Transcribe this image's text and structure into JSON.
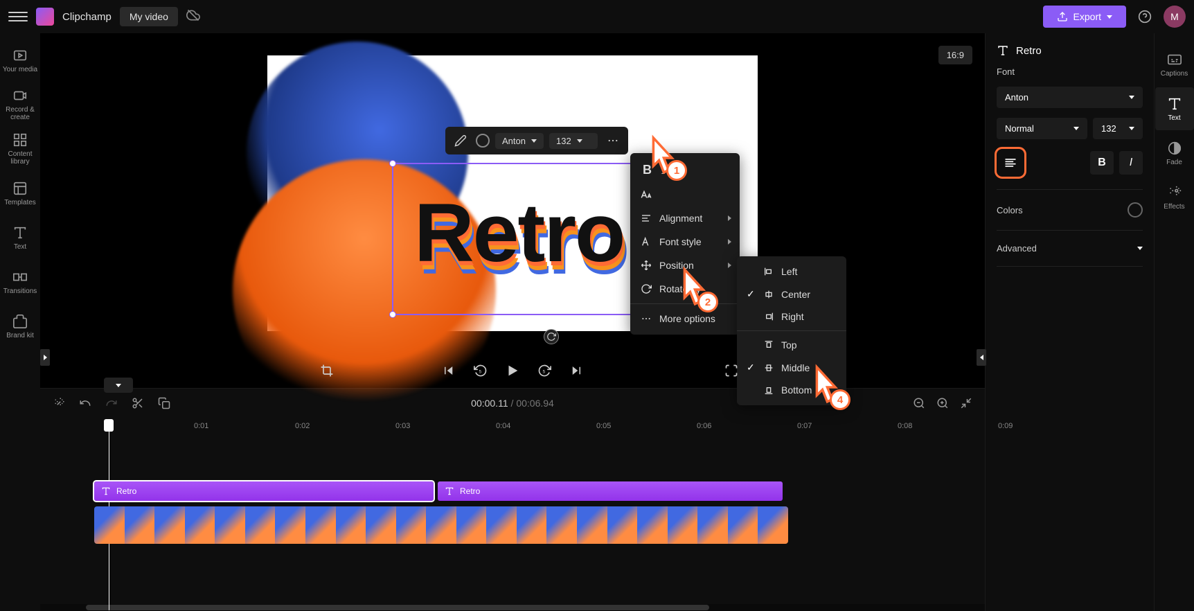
{
  "topbar": {
    "app_name": "Clipchamp",
    "tab_name": "My video",
    "export_label": "Export",
    "avatar_letter": "M"
  },
  "sidebar_left": {
    "items": [
      {
        "label": "Your media"
      },
      {
        "label": "Record & create"
      },
      {
        "label": "Content library"
      },
      {
        "label": "Templates"
      },
      {
        "label": "Text"
      },
      {
        "label": "Transitions"
      },
      {
        "label": "Brand kit"
      }
    ]
  },
  "preview": {
    "aspect": "16:9",
    "text_content": "Retro"
  },
  "float_toolbar": {
    "font": "Anton",
    "size": "132"
  },
  "ctx_menu": {
    "items": [
      {
        "label": "Alignment"
      },
      {
        "label": "Font style"
      },
      {
        "label": "Position"
      },
      {
        "label": "Rotate by"
      },
      {
        "label": "More options"
      }
    ]
  },
  "sub_menu": {
    "items": [
      {
        "label": "Left",
        "checked": false
      },
      {
        "label": "Center",
        "checked": true
      },
      {
        "label": "Right",
        "checked": false
      },
      {
        "label": "Top",
        "checked": false
      },
      {
        "label": "Middle",
        "checked": true
      },
      {
        "label": "Bottom",
        "checked": false
      }
    ]
  },
  "pointers": {
    "p1": "1",
    "p2": "2",
    "p4": "4"
  },
  "timeline": {
    "current": "00:00.11",
    "sep": " / ",
    "total": "00:06.94",
    "ticks": [
      "0:01",
      "0:02",
      "0:03",
      "0:04",
      "0:05",
      "0:06",
      "0:07",
      "0:08",
      "0:09"
    ],
    "clip1_label": "Retro",
    "clip2_label": "Retro"
  },
  "right_panel": {
    "title": "Retro",
    "font_section": "Font",
    "font_name": "Anton",
    "weight": "Normal",
    "size": "132",
    "bold": "B",
    "italic": "I",
    "colors_label": "Colors",
    "advanced_label": "Advanced"
  },
  "rail_right": {
    "items": [
      {
        "label": "Captions"
      },
      {
        "label": "Text"
      },
      {
        "label": "Fade"
      },
      {
        "label": "Effects"
      }
    ]
  }
}
